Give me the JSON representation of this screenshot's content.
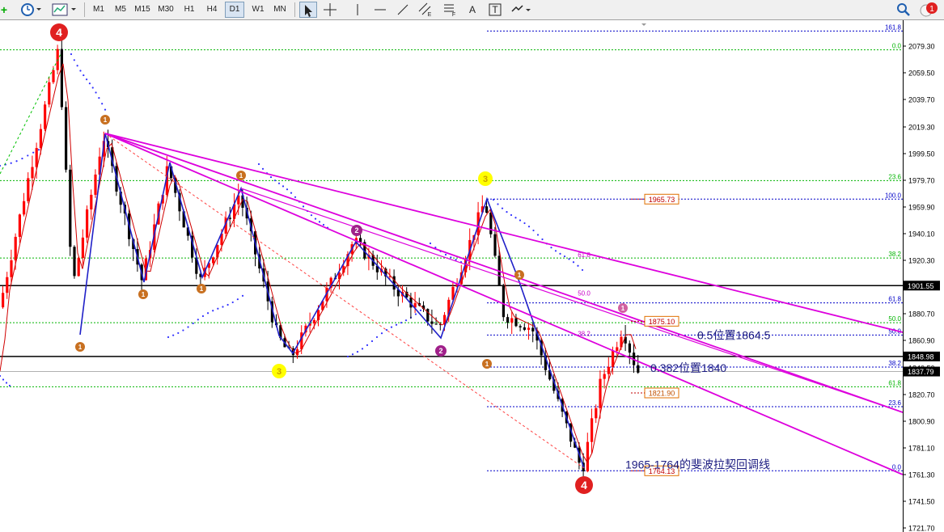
{
  "toolbar": {
    "timeframes": [
      "M1",
      "M5",
      "M15",
      "M30",
      "H1",
      "H4",
      "D1",
      "W1",
      "MN"
    ],
    "selected_timeframe": "D1",
    "drawing_tools": [
      "cursor-icon",
      "crosshair-icon",
      "vertical-line-icon",
      "horizontal-line-icon",
      "trendline-icon",
      "equidistant-channel-icon",
      "fibonacci-icon",
      "text-icon",
      "text-label-icon",
      "arrows-icon"
    ],
    "tool_letters": {
      "equidistant": "E",
      "fibonacci": "F",
      "text": "A",
      "text_label": "T"
    },
    "notification_count": "1"
  },
  "price_axis": {
    "ticks": [
      "2079.30",
      "2059.50",
      "2039.70",
      "2019.30",
      "1999.50",
      "1979.70",
      "1959.90",
      "1940.10",
      "1920.30",
      "1900.50",
      "1880.70",
      "1860.90",
      "1840.50",
      "1820.70",
      "1800.90",
      "1781.10",
      "1761.30",
      "1741.50",
      "1721.70"
    ],
    "ticks_num": [
      2079.3,
      2059.5,
      2039.7,
      2019.3,
      1999.5,
      1979.7,
      1959.9,
      1940.1,
      1920.3,
      1900.5,
      1880.7,
      1860.9,
      1840.5,
      1820.7,
      1800.9,
      1781.1,
      1761.3,
      1741.5,
      1721.7
    ],
    "highlight_labels": [
      {
        "text": "1901.55",
        "price": 1901.55,
        "bg": "#000000",
        "fg": "#ffffff"
      },
      {
        "text": "1848.98",
        "price": 1848.98,
        "bg": "#000000",
        "fg": "#ffffff"
      },
      {
        "text": "1837.79",
        "price": 1837.79,
        "bg": "#000000",
        "fg": "#ffffff"
      }
    ]
  },
  "fib_main": {
    "range": [
      1965.73,
      1764.13
    ],
    "levels": [
      {
        "label": "161.8",
        "price": 2090.5
      },
      {
        "label": "100.0",
        "price": 1965.73
      },
      {
        "label": "61.8",
        "price": 1888.7
      },
      {
        "label": "50.0",
        "price": 1864.9
      },
      {
        "label": "38.2",
        "price": 1841.1
      },
      {
        "label": "23.6",
        "price": 1811.7
      },
      {
        "label": "0.0",
        "price": 1764.13
      }
    ],
    "color": "#0000c8"
  },
  "fib_green": {
    "levels": [
      {
        "label": "0.0",
        "price": 2076.5
      },
      {
        "label": "23.6",
        "price": 1979.5
      },
      {
        "label": "38.2",
        "price": 1922.0
      },
      {
        "label": "50.0",
        "price": 1874.0
      },
      {
        "label": "61.8",
        "price": 1826.5
      }
    ],
    "color": "#00b400"
  },
  "fib_inner": {
    "levels": [
      {
        "label": "61.8",
        "price": 1921.5
      },
      {
        "label": "50.0",
        "price": 1893.0
      },
      {
        "label": "38.2",
        "price": 1863.0
      }
    ],
    "color": "#c800c8"
  },
  "price_labels": [
    {
      "text": "1965.73",
      "price": 1965.73,
      "fg": "#c00000",
      "border": "#e07000"
    },
    {
      "text": "1875.10",
      "price": 1875.1,
      "fg": "#c00000",
      "border": "#e07000"
    },
    {
      "text": "1821.90",
      "price": 1821.9,
      "fg": "#c05000",
      "border": "#e07000"
    },
    {
      "text": "1764.13",
      "price": 1764.13,
      "fg": "#c00000",
      "border": "#e07000"
    }
  ],
  "annotations": {
    "level_05": "0.5位置1864.5",
    "level_0382": "0.382位置1840",
    "fib_title": "1965-1764的斐波拉契回调线"
  },
  "wave_markers": [
    {
      "text": "4",
      "type": "red"
    },
    {
      "text": "4",
      "type": "red"
    },
    {
      "text": "3",
      "type": "yellow"
    },
    {
      "text": "3",
      "type": "yellow"
    },
    {
      "text": "2",
      "type": "purple"
    },
    {
      "text": "2",
      "type": "purple"
    },
    {
      "text": "1",
      "type": "orange"
    },
    {
      "text": "1",
      "type": "orange"
    },
    {
      "text": "1",
      "type": "orange"
    },
    {
      "text": "1",
      "type": "orange"
    },
    {
      "text": "1",
      "type": "orange"
    },
    {
      "text": "1",
      "type": "orange"
    },
    {
      "text": "1",
      "type": "orange"
    },
    {
      "text": "1",
      "type": "pink"
    }
  ],
  "colors": {
    "bull": "#ff0000",
    "bear": "#000000",
    "trendline": "#dd00dd",
    "wave_line": "#2020c8",
    "ma": "#d00000",
    "sar": "#3030ff"
  }
}
